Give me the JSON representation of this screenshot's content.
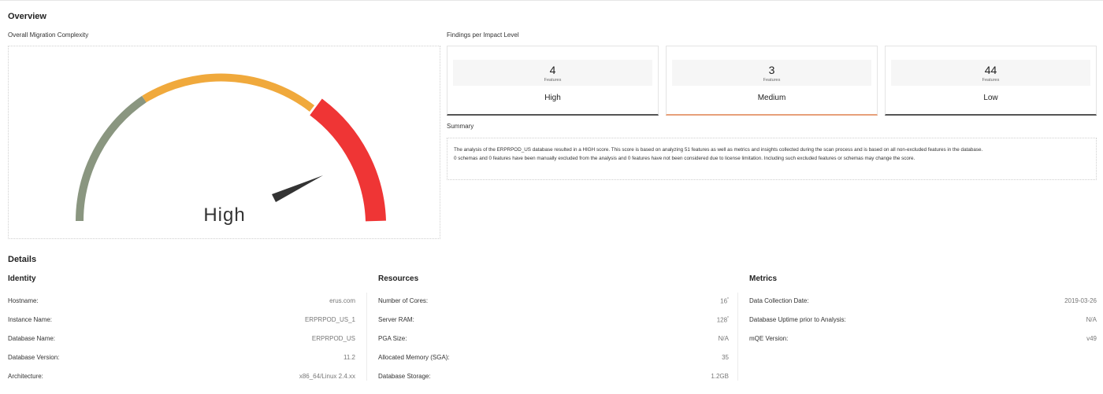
{
  "overview": {
    "title": "Overview",
    "complexity_label": "Overall Migration Complexity",
    "gauge": {
      "value_label": "High",
      "level": "High",
      "colors": {
        "low": "#8a9680",
        "medium": "#f0a93c",
        "high": "#ef3535",
        "needle": "#333333"
      }
    },
    "findings_label": "Findings per Impact Level",
    "findings": [
      {
        "count": "4",
        "unit": "Features",
        "level": "High"
      },
      {
        "count": "3",
        "unit": "Features",
        "level": "Medium"
      },
      {
        "count": "44",
        "unit": "Features",
        "level": "Low"
      }
    ],
    "summary_label": "Summary",
    "summary_lines": [
      "The analysis of the ERPRPOD_US database resulted in a HIGH score. This score is based on analyzing 51 features as well as metrics and insights collected during the scan process and is based on all non-excluded features in the database.",
      "0 schemas and 0 features have been manually excluded from the analysis and 0 features have not been considered due to license limitation. Including such excluded features or schemas may change the score."
    ]
  },
  "details": {
    "title": "Details",
    "identity": {
      "title": "Identity",
      "rows": [
        {
          "key": "Hostname:",
          "value": "erus.com"
        },
        {
          "key": "Instance Name:",
          "value": "ERPRPOD_US_1"
        },
        {
          "key": "Database Name:",
          "value": "ERPRPOD_US"
        },
        {
          "key": "Database Version:",
          "value": "11.2"
        },
        {
          "key": "Architecture:",
          "value": "x86_64/Linux 2.4.xx"
        }
      ]
    },
    "resources": {
      "title": "Resources",
      "rows": [
        {
          "key": "Number of Cores:",
          "value": "16",
          "mark": "*"
        },
        {
          "key": "Server RAM:",
          "value": "128",
          "mark": "*"
        },
        {
          "key": "PGA Size:",
          "value": "N/A",
          "mark": ""
        },
        {
          "key": "Allocated Memory (SGA):",
          "value": "35",
          "mark": ""
        },
        {
          "key": "Database Storage:",
          "value": "1.2GB",
          "mark": ""
        }
      ]
    },
    "metrics": {
      "title": "Metrics",
      "rows": [
        {
          "key": "Data Collection Date:",
          "value": "2019-03-26"
        },
        {
          "key": "Database Uptime prior to Analysis:",
          "value": "N/A"
        },
        {
          "key": "mQE Version:",
          "value": "v49"
        }
      ]
    }
  }
}
